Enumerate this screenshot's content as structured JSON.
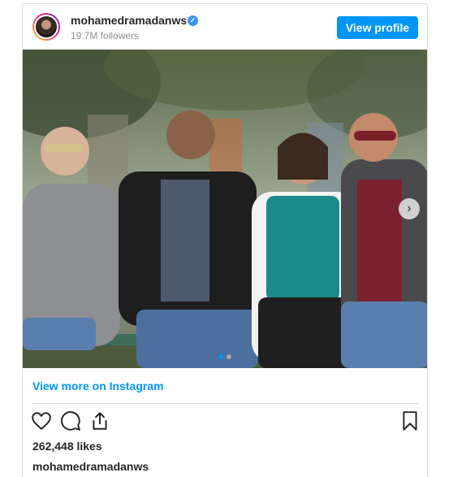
{
  "page": {
    "edge_fragment": ""
  },
  "post": {
    "header": {
      "username": "mohamedramadanws",
      "verified_glyph": "✓",
      "followers": "19.7M followers",
      "view_profile_label": "View profile"
    },
    "carousel": {
      "next_glyph": "›",
      "current_slide": 1,
      "slide_count": 2
    },
    "view_more_label": "View more on Instagram",
    "actions": {
      "icons": [
        "heart-icon",
        "comment-icon",
        "share-icon",
        "bookmark-icon"
      ]
    },
    "likes": "262,448 likes",
    "caption_username": "mohamedramadanws"
  },
  "colors": {
    "accent": "#0095f6",
    "text": "#262626",
    "muted": "#8e8e8e",
    "border": "#dbdbdb",
    "verified": "#3897f0"
  }
}
